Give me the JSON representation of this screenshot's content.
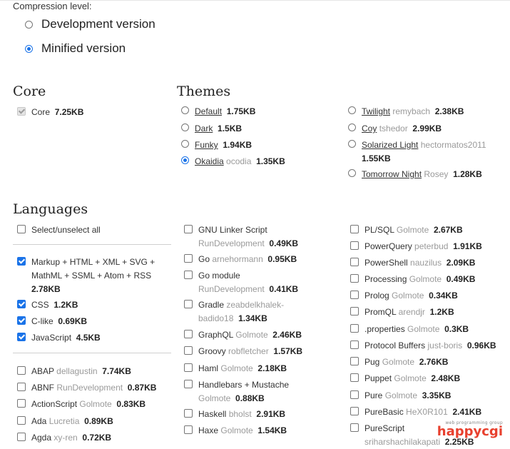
{
  "compression": {
    "label": "Compression level:",
    "options": [
      {
        "label": "Development version",
        "selected": false
      },
      {
        "label": "Minified version",
        "selected": true
      }
    ]
  },
  "core": {
    "title": "Core",
    "item": {
      "label": "Core",
      "size": "7.25KB"
    }
  },
  "themes": {
    "title": "Themes",
    "left": [
      {
        "name": "Default",
        "author": "",
        "size": "1.75KB",
        "selected": false
      },
      {
        "name": "Dark",
        "author": "",
        "size": "1.5KB",
        "selected": false
      },
      {
        "name": "Funky",
        "author": "",
        "size": "1.94KB",
        "selected": false
      },
      {
        "name": "Okaidia",
        "author": "ocodia",
        "size": "1.35KB",
        "selected": true
      }
    ],
    "right": [
      {
        "name": "Twilight",
        "author": "remybach",
        "size": "2.38KB",
        "selected": false
      },
      {
        "name": "Coy",
        "author": "tshedor",
        "size": "2.99KB",
        "selected": false
      },
      {
        "name": "Solarized Light",
        "author": "hectormatos2011",
        "size": "1.55KB",
        "selected": false
      },
      {
        "name": "Tomorrow Night",
        "author": "Rosey",
        "size": "1.28KB",
        "selected": false
      }
    ]
  },
  "languages": {
    "title": "Languages",
    "select_all": "Select/unselect all",
    "selected": [
      {
        "name": "Markup + HTML + XML + SVG + MathML + SSML + Atom + RSS",
        "author": "",
        "size": "2.78KB"
      },
      {
        "name": "CSS",
        "author": "",
        "size": "1.2KB"
      },
      {
        "name": "C-like",
        "author": "",
        "size": "0.69KB"
      },
      {
        "name": "JavaScript",
        "author": "",
        "size": "4.5KB"
      }
    ],
    "col1": [
      {
        "name": "ABAP",
        "author": "dellagustin",
        "size": "7.74KB"
      },
      {
        "name": "ABNF",
        "author": "RunDevelopment",
        "size": "0.87KB"
      },
      {
        "name": "ActionScript",
        "author": "Golmote",
        "size": "0.83KB"
      },
      {
        "name": "Ada",
        "author": "Lucretia",
        "size": "0.89KB"
      },
      {
        "name": "Agda",
        "author": "xy-ren",
        "size": "0.72KB"
      }
    ],
    "col2": [
      {
        "name": "GNU Linker Script",
        "author": "RunDevelopment",
        "size": "0.49KB"
      },
      {
        "name": "Go",
        "author": "arnehormann",
        "size": "0.95KB"
      },
      {
        "name": "Go module",
        "author": "RunDevelopment",
        "size": "0.41KB"
      },
      {
        "name": "Gradle",
        "author": "zeabdelkhalek-badido18",
        "size": "1.34KB"
      },
      {
        "name": "GraphQL",
        "author": "Golmote",
        "size": "2.46KB"
      },
      {
        "name": "Groovy",
        "author": "robfletcher",
        "size": "1.57KB"
      },
      {
        "name": "Haml",
        "author": "Golmote",
        "size": "2.18KB"
      },
      {
        "name": "Handlebars + Mustache",
        "author": "Golmote",
        "size": "0.88KB"
      },
      {
        "name": "Haskell",
        "author": "bholst",
        "size": "2.91KB"
      },
      {
        "name": "Haxe",
        "author": "Golmote",
        "size": "1.54KB"
      }
    ],
    "col3": [
      {
        "name": "PL/SQL",
        "author": "Golmote",
        "size": "2.67KB"
      },
      {
        "name": "PowerQuery",
        "author": "peterbud",
        "size": "1.91KB"
      },
      {
        "name": "PowerShell",
        "author": "nauzilus",
        "size": "2.09KB"
      },
      {
        "name": "Processing",
        "author": "Golmote",
        "size": "0.49KB"
      },
      {
        "name": "Prolog",
        "author": "Golmote",
        "size": "0.34KB"
      },
      {
        "name": "PromQL",
        "author": "arendjr",
        "size": "1.2KB"
      },
      {
        "name": ".properties",
        "author": "Golmote",
        "size": "0.3KB"
      },
      {
        "name": "Protocol Buffers",
        "author": "just-boris",
        "size": "0.96KB"
      },
      {
        "name": "Pug",
        "author": "Golmote",
        "size": "2.76KB"
      },
      {
        "name": "Puppet",
        "author": "Golmote",
        "size": "2.48KB"
      },
      {
        "name": "Pure",
        "author": "Golmote",
        "size": "3.35KB"
      },
      {
        "name": "PureBasic",
        "author": "HeX0R101",
        "size": "2.41KB"
      },
      {
        "name": "PureScript",
        "author": "sriharshachilakapati",
        "size": "2.25KB"
      }
    ]
  },
  "watermark": {
    "brand": "happycgi",
    "tagline": "web programming group"
  },
  "colors": {
    "accent": "#1a73e8",
    "author": "#9a9a9a",
    "watermark": "#e8402e"
  }
}
